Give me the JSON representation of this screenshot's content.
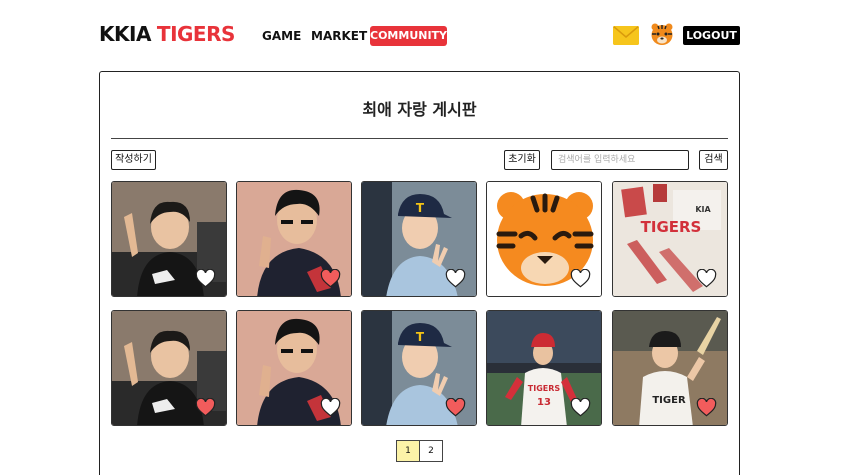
{
  "header": {
    "logo_part1": "KKIA",
    "logo_part2": "TIGERS",
    "nav": [
      "GAME",
      "MARKET",
      "COMMUNITY"
    ],
    "active_nav": "COMMUNITY",
    "logout_label": "LOGOUT"
  },
  "board": {
    "title": "최애 자랑 게시판",
    "write_button": "작성하기",
    "reset_button": "초기화",
    "search_placeholder": "검색어를 입력하세요",
    "search_button": "검색"
  },
  "posts": [
    {
      "image": "player-photo",
      "liked": false
    },
    {
      "image": "player-photo",
      "liked": true
    },
    {
      "image": "player-photo",
      "liked": false
    },
    {
      "image": "tiger-mascot-icon",
      "liked": false
    },
    {
      "image": "merchandise-photo",
      "liked": false
    },
    {
      "image": "player-photo",
      "liked": true
    },
    {
      "image": "player-photo",
      "liked": false
    },
    {
      "image": "player-photo",
      "liked": true
    },
    {
      "image": "player-photo",
      "liked": false
    },
    {
      "image": "player-photo",
      "liked": true
    }
  ],
  "pagination": {
    "pages": [
      "1",
      "2"
    ],
    "current": "1"
  },
  "colors": {
    "brand_red": "#e8333a",
    "heart_fill": "#f25c5c",
    "active_page": "#fcf3a8",
    "mail_yellow": "#f6c51c"
  }
}
